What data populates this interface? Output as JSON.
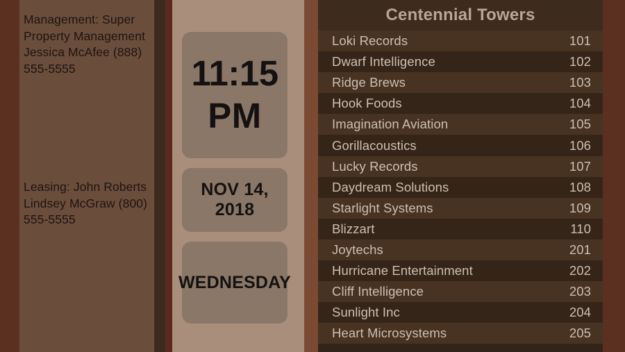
{
  "colors": {
    "frame": "#5c3020",
    "left_panel": "#6b4d3c",
    "mid_panel": "#a98e7c",
    "mid_box": "#8a7768",
    "directory_bg": "#33241a",
    "row_odd": "#483322",
    "row_even": "#352519",
    "header_text": "#b9a595",
    "row_text": "#cdbfb2",
    "contact_text": "#1d1410"
  },
  "left": {
    "management": {
      "lines": [
        "Management: Super",
        "Property Management",
        "Jessica McAfee (888)",
        "555-5555"
      ]
    },
    "leasing": {
      "lines": [
        "Leasing: John Roberts",
        "Lindsey McGraw (800)",
        "555-5555"
      ]
    }
  },
  "clock": {
    "time": "11:15",
    "meridiem": "PM",
    "date": "NOV 14, 2018",
    "day": "WEDNESDAY"
  },
  "directory": {
    "title": "Centennial Towers",
    "rows": [
      {
        "name": "Loki Records",
        "suite": "101"
      },
      {
        "name": "Dwarf Intelligence",
        "suite": "102"
      },
      {
        "name": "Ridge Brews",
        "suite": "103"
      },
      {
        "name": "Hook Foods",
        "suite": "104"
      },
      {
        "name": "Imagination Aviation",
        "suite": "105"
      },
      {
        "name": "Gorillacoustics",
        "suite": "106"
      },
      {
        "name": "Lucky Records",
        "suite": "107"
      },
      {
        "name": "Daydream Solutions",
        "suite": "108"
      },
      {
        "name": "Starlight Systems",
        "suite": "109"
      },
      {
        "name": "Blizzart",
        "suite": "110"
      },
      {
        "name": "Joytechs",
        "suite": "201"
      },
      {
        "name": "Hurricane Entertainment",
        "suite": "202"
      },
      {
        "name": "Cliff Intelligence",
        "suite": "203"
      },
      {
        "name": "Sunlight Inc",
        "suite": "204"
      },
      {
        "name": "Heart Microsystems",
        "suite": "205"
      }
    ]
  }
}
